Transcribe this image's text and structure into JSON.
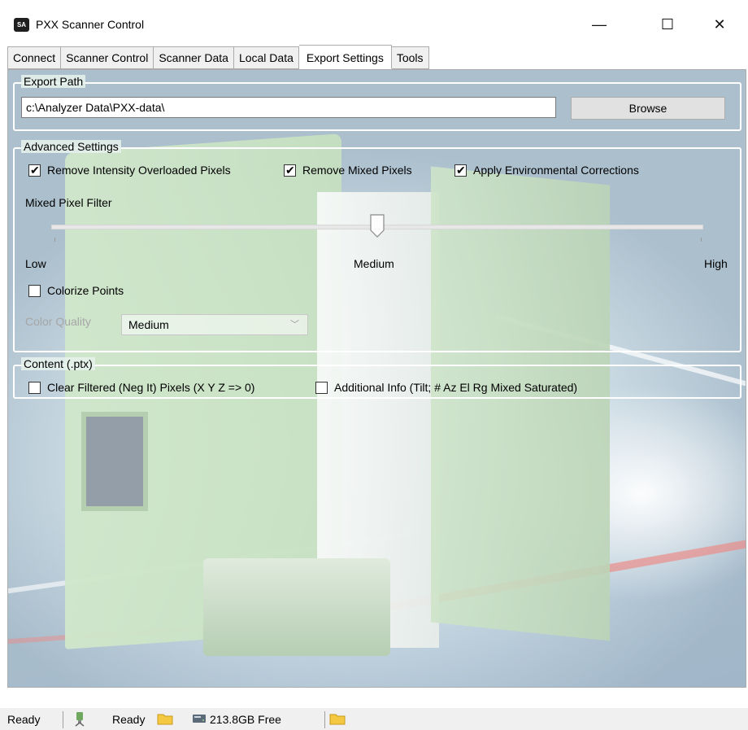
{
  "window": {
    "title": "PXX Scanner Control",
    "icon_text": "SA",
    "minimize_glyph": "—",
    "maximize_glyph": "☐",
    "close_glyph": "✕"
  },
  "tabs": [
    {
      "label": "Connect"
    },
    {
      "label": "Scanner Control"
    },
    {
      "label": "Scanner Data"
    },
    {
      "label": "Local Data"
    },
    {
      "label": "Export Settings",
      "active": true
    },
    {
      "label": "Tools"
    }
  ],
  "export_path": {
    "legend": "Export Path",
    "value": "c:\\Analyzer Data\\PXX-data\\",
    "browse_label": "Browse"
  },
  "advanced": {
    "legend": "Advanced Settings",
    "remove_intensity_label": "Remove Intensity Overloaded Pixels",
    "remove_intensity_checked": true,
    "remove_mixed_label": "Remove Mixed Pixels",
    "remove_mixed_checked": true,
    "apply_env_label": "Apply Environmental Corrections",
    "apply_env_checked": true,
    "mixed_filter_label": "Mixed Pixel Filter",
    "slider_low": "Low",
    "slider_mid": "Medium",
    "slider_high": "High",
    "slider_value_fraction": 0.5,
    "colorize_label": "Colorize Points",
    "colorize_checked": false,
    "color_quality_label": "Color Quality",
    "color_quality_value": "Medium"
  },
  "content": {
    "legend": "Content (.ptx)",
    "clear_filtered_label": "Clear Filtered (Neg It) Pixels (X Y Z => 0)",
    "clear_filtered_checked": false,
    "additional_info_label": "Additional Info (Tilt; # Az El Rg Mixed Saturated)",
    "additional_info_checked": false
  },
  "status": {
    "left_text": "Ready",
    "mid_text": "Ready",
    "disk_text": "213.8GB Free"
  },
  "colors": {
    "accent_green": "#a8cfa0",
    "folder_yellow": "#f5c842",
    "streak_red": "#e0504a"
  }
}
